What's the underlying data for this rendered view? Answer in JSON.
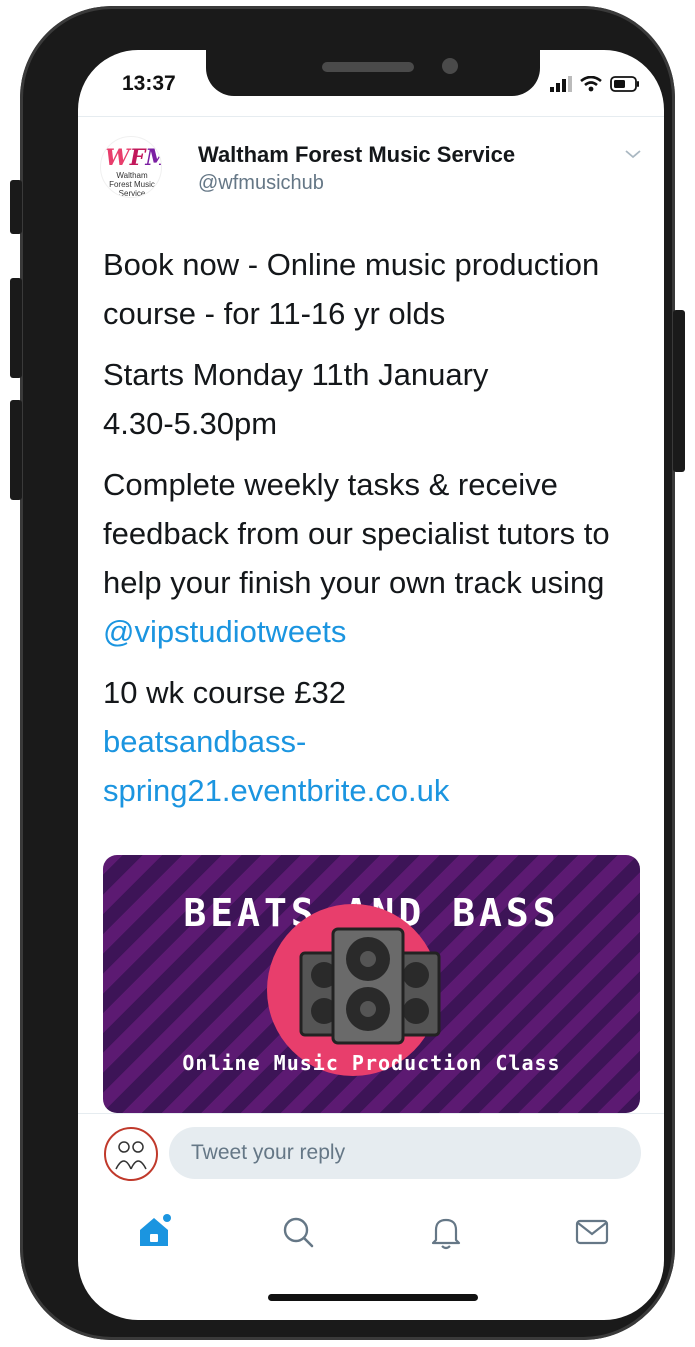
{
  "status_bar": {
    "time": "13:37"
  },
  "tweet": {
    "avatar_logo": "WFMS",
    "avatar_logo_sub": "Waltham Forest Music Service",
    "display_name": "Waltham Forest Music Service",
    "handle": "@wfmusichub",
    "paragraphs": {
      "p1": "Book now - Online music production course - for 11-16 yr olds",
      "p2": "Starts Monday 11th January 4.30-5.30pm",
      "p3_text": "Complete weekly tasks & receive feedback from our specialist tutors to help your finish your own track using ",
      "p3_mention": "@vipstudiotweets",
      "p4_text": "10 wk course £32",
      "p4_link": "beatsandbass-spring21.eventbrite.co.uk"
    },
    "media": {
      "title": "BEATS AND BASS",
      "subtitle": "Online Music Production Class"
    }
  },
  "reply": {
    "placeholder": "Tweet your reply"
  },
  "tabbar": {
    "items": [
      {
        "icon": "home-icon",
        "active": true
      },
      {
        "icon": "search-icon",
        "active": false
      },
      {
        "icon": "notifications-icon",
        "active": false
      },
      {
        "icon": "messages-icon",
        "active": false
      }
    ]
  },
  "colors": {
    "accent": "#1b95e0",
    "text": "#14171a",
    "muted": "#657786",
    "media_purple": "#5c1a72",
    "media_pink": "#e83e6c"
  }
}
